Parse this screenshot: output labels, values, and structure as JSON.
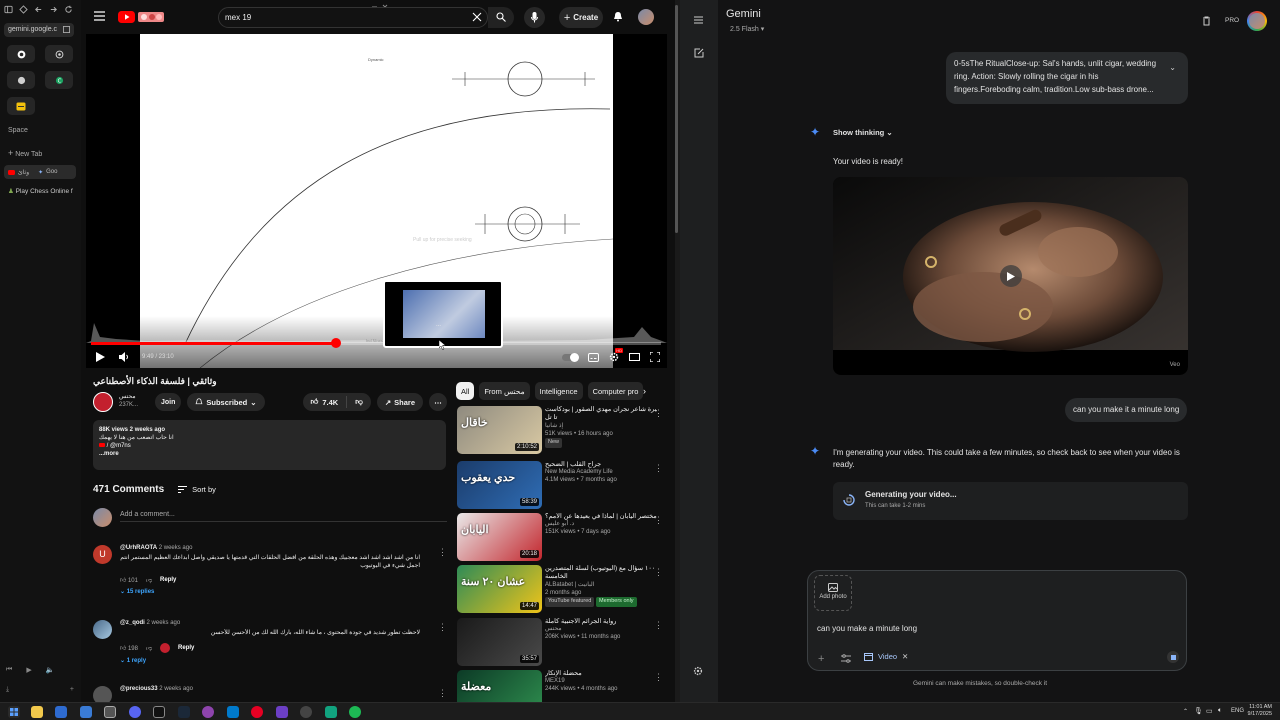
{
  "browser": {
    "url_label": "gemini.google.c",
    "space_label": "Space",
    "new_tab_label": "New Tab",
    "tab_a_label": "وثائ",
    "tab_b_label": "Goo",
    "chess_label": "Play Chess Online f"
  },
  "youtube": {
    "search_value": "mex 19",
    "create_label": "Create",
    "player": {
      "time": "9:49 / 23:10",
      "progress": 0.43,
      "frame_small_text": "Dynamic",
      "preview_hint": "Pull up for precise seeking",
      "preview_label": "...",
      "frame_caption": "Ind Nines"
    },
    "video_title": "وثائقي | فلسفة الذكاء الأصطناعي",
    "channel_name": "محتس",
    "subscribers": "237K...",
    "join_label": "Join",
    "subscribed_label": "Subscribed",
    "likes": "7.4K",
    "share_label": "Share",
    "desc_stats": "88K views  2 weeks ago",
    "desc_line": "انا حاب اتصعب من هنا لا يهمك",
    "desc_handle": "/ @m7ns",
    "desc_more": "...more",
    "comments_count": "471 Comments",
    "sort_label": "Sort by",
    "add_comment_placeholder": "Add a comment...",
    "comments": [
      {
        "author": "@UrhRAOTA",
        "time": "2 weeks ago",
        "text": "انا من اشد اشد اشد اشد معجبيك وهذه الحلقة من افضل الحلقات التي قدمتها يا صديقي واصل ابداعك العظيم المستمر انتم اجمل شيء في اليوتيوب",
        "likes": "101",
        "reply_label": "Reply",
        "replies": "15 replies",
        "initial": "U"
      },
      {
        "author": "@z_qodi",
        "time": "2 weeks ago",
        "text": "لاحظت تطور شديد في جودة المحتوى ، ما شاء الله، بارك الله لك من الأحسن للأحسن",
        "likes": "198",
        "reply_label": "Reply",
        "replies": "1 reply",
        "initial": ""
      },
      {
        "author": "@precious33",
        "time": "2 weeks ago",
        "text": "",
        "likes": "",
        "reply_label": "",
        "replies": "",
        "initial": ""
      }
    ],
    "chips": [
      "All",
      "From محتس",
      "Intelligence",
      "Computer pro"
    ],
    "recs": [
      {
        "title": "مسيرة شاعر نجران مهدي الصقور | بودكاست",
        "line2": "تا تل",
        "channel": "إذ شانيا",
        "views": "51K views • 16 hours ago",
        "badge": "New",
        "duration": "2:10:52",
        "thumb_text": "خاقال",
        "c1": "#8e8a7f",
        "c2": "#d9c9a3"
      },
      {
        "title": "جراح القلب | الضحيح",
        "line2": "",
        "channel": "New Media Academy Life",
        "views": "4.1M views • 7 months ago",
        "badge": "",
        "duration": "58:39",
        "thumb_text": "حدي يعقوب",
        "c1": "#1b3c6b",
        "c2": "#2f6db5"
      },
      {
        "title": "مختصر اليابان | لماذا في بعيدها عن الأمم؟",
        "line2": "",
        "channel": "د. أبو عليس",
        "views": "151K views • 7 days ago",
        "badge": "",
        "duration": "20:18",
        "thumb_text": "اليابان",
        "c1": "#e9e9e9",
        "c2": "#c3262d"
      },
      {
        "title": "١٠٠ سؤال مع (اليوتيوب) لسلة المتصدرين",
        "line2": "الخامسة",
        "channel": "ALBatabet | البانيت",
        "views": "2 months ago",
        "badge": "YouTube featured",
        "badge2": "Members only",
        "duration": "14:47",
        "thumb_text": "عشان ٢٠ سنة",
        "c1": "#2e8b57",
        "c2": "#f0c419"
      },
      {
        "title": "رواية الجرائم الأجنبية كاملة",
        "line2": "",
        "channel": "محتس",
        "views": "206K views • 11 months ago",
        "badge": "",
        "duration": "35:57",
        "thumb_text": "",
        "c1": "#1a1a1a",
        "c2": "#4a4a4a"
      },
      {
        "title": "محضلة الإنكار",
        "line2": "",
        "channel": "MEX19",
        "views": "244K views • 4 months ago",
        "badge": "",
        "duration": "",
        "thumb_text": "معضلة",
        "c1": "#0c3a26",
        "c2": "#2f8f4f"
      }
    ]
  },
  "gemini": {
    "title": "Gemini",
    "model": "2.5 Flash",
    "pro_badge": "PRO",
    "prompt_text": "0-5sThe RitualClose-up: Sal's hands, unlit cigar, wedding ring. Action: Slowly rolling the cigar in his fingers.Foreboding calm, tradition.Low sub-bass drone...",
    "show_thinking": "Show thinking",
    "ready_text": "Your video is ready!",
    "veo_label": "Veo",
    "user_msg": "can you make it a minute long",
    "generating_text": "I'm generating your video. This could take a few minutes, so check back to see when your video is ready.",
    "gen_title": "Generating your video...",
    "gen_sub": "This can take 1-2 mins",
    "add_photo": "Add photo",
    "input_value": "can you make a minute long",
    "video_chip": "Video",
    "disclaimer": "Gemini can make mistakes, so double-check it"
  },
  "taskbar": {
    "lang": "ENG",
    "time": "11:01 AM",
    "date": "9/17/2025"
  }
}
